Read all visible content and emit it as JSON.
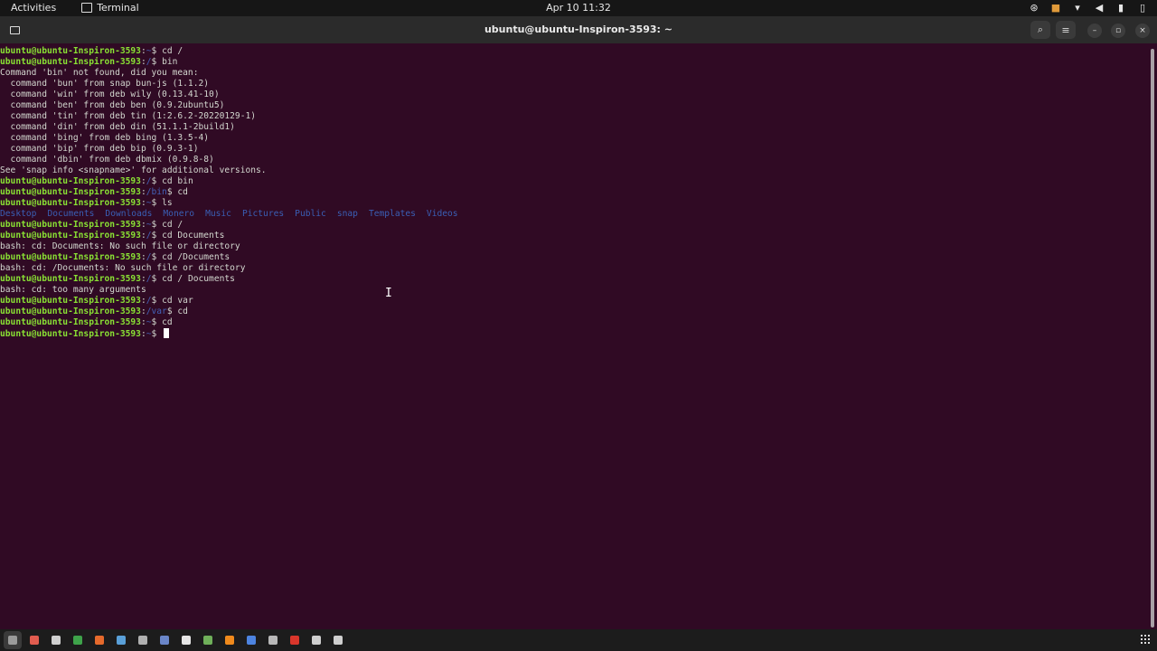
{
  "topbar": {
    "activities": "Activities",
    "app_name": "Terminal",
    "clock": "Apr 10  11:32"
  },
  "window": {
    "title": "ubuntu@ubuntu-Inspiron-3593: ~"
  },
  "terminal": {
    "prompt": "ubuntu@ubuntu-Inspiron-3593",
    "lines": [
      {
        "kind": "prompt",
        "path": "~",
        "cmd": "cd /"
      },
      {
        "kind": "prompt",
        "path": "/",
        "cmd": "bin"
      },
      {
        "kind": "text",
        "text": "Command 'bin' not found, did you mean:"
      },
      {
        "kind": "text",
        "text": "  command 'bun' from snap bun-js (1.1.2)"
      },
      {
        "kind": "text",
        "text": "  command 'win' from deb wily (0.13.41-10)"
      },
      {
        "kind": "text",
        "text": "  command 'ben' from deb ben (0.9.2ubuntu5)"
      },
      {
        "kind": "text",
        "text": "  command 'tin' from deb tin (1:2.6.2-20220129-1)"
      },
      {
        "kind": "text",
        "text": "  command 'din' from deb din (51.1.1-2build1)"
      },
      {
        "kind": "text",
        "text": "  command 'bing' from deb bing (1.3.5-4)"
      },
      {
        "kind": "text",
        "text": "  command 'bip' from deb bip (0.9.3-1)"
      },
      {
        "kind": "text",
        "text": "  command 'dbin' from deb dbmix (0.9.8-8)"
      },
      {
        "kind": "text",
        "text": "See 'snap info <snapname>' for additional versions."
      },
      {
        "kind": "prompt",
        "path": "/",
        "cmd": "cd bin"
      },
      {
        "kind": "prompt",
        "path": "/bin",
        "cmd": "cd"
      },
      {
        "kind": "prompt",
        "path": "~",
        "cmd": "ls"
      },
      {
        "kind": "ls",
        "items": [
          "Desktop",
          "Documents",
          "Downloads",
          "Monero",
          "Music",
          "Pictures",
          "Public",
          "snap",
          "Templates",
          "Videos"
        ]
      },
      {
        "kind": "prompt",
        "path": "~",
        "cmd": "cd /"
      },
      {
        "kind": "prompt",
        "path": "/",
        "cmd": "cd Documents"
      },
      {
        "kind": "text",
        "text": "bash: cd: Documents: No such file or directory"
      },
      {
        "kind": "prompt",
        "path": "/",
        "cmd": "cd /Documents"
      },
      {
        "kind": "text",
        "text": "bash: cd: /Documents: No such file or directory"
      },
      {
        "kind": "prompt",
        "path": "/",
        "cmd": "cd / Documents"
      },
      {
        "kind": "text",
        "text": "bash: cd: too many arguments"
      },
      {
        "kind": "prompt",
        "path": "/",
        "cmd": "cd var"
      },
      {
        "kind": "prompt",
        "path": "/var",
        "cmd": "cd"
      },
      {
        "kind": "prompt",
        "path": "~",
        "cmd": "cd"
      },
      {
        "kind": "prompt",
        "path": "~",
        "cmd": "",
        "cursor": true
      }
    ]
  },
  "dock": {
    "apps": [
      {
        "name": "show-desktop",
        "color": "#9a9a9a",
        "active": true
      },
      {
        "name": "files",
        "color": "#e15c4f"
      },
      {
        "name": "text-editor",
        "color": "#d0d0d0"
      },
      {
        "name": "chrome",
        "color": "#3ea34a"
      },
      {
        "name": "firefox",
        "color": "#e66a2c"
      },
      {
        "name": "steam",
        "color": "#5aa0d8"
      },
      {
        "name": "settings",
        "color": "#b0b0b0"
      },
      {
        "name": "app-center",
        "color": "#6a86c8"
      },
      {
        "name": "disks",
        "color": "#e6e6e6"
      },
      {
        "name": "monitor",
        "color": "#6fb05a"
      },
      {
        "name": "vlc",
        "color": "#f08a1c"
      },
      {
        "name": "chromium",
        "color": "#4d84e0"
      },
      {
        "name": "tool",
        "color": "#b8b8b8"
      },
      {
        "name": "app-red",
        "color": "#d9362b"
      },
      {
        "name": "documents",
        "color": "#cfcfcf"
      },
      {
        "name": "trash",
        "color": "#cfcfcf"
      }
    ]
  },
  "colors": {
    "terminal_bg": "#300a24",
    "prompt_green": "#8ae234",
    "path_blue": "#4462b8"
  }
}
